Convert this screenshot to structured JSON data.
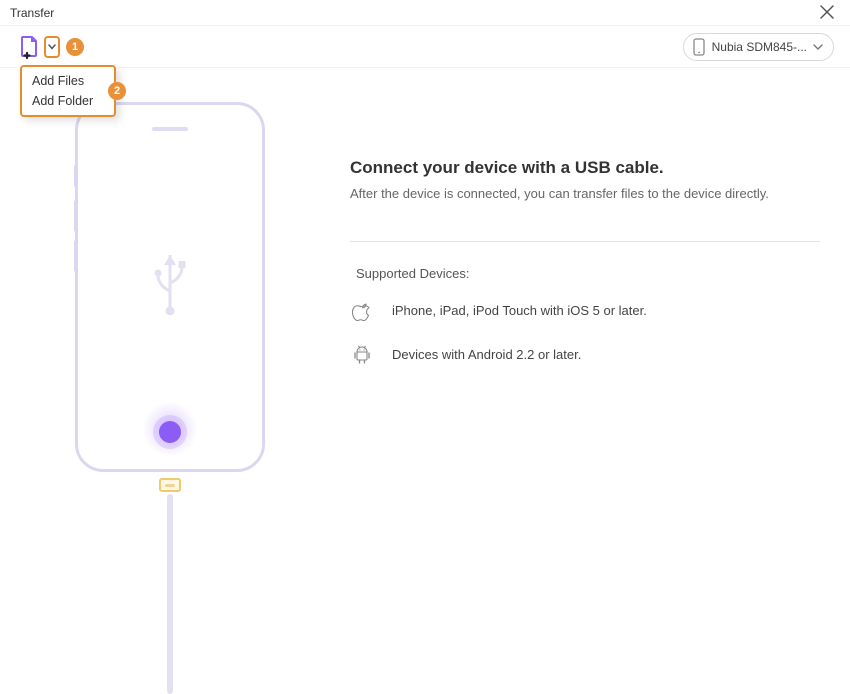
{
  "window": {
    "title": "Transfer"
  },
  "toolbar": {
    "dropdown": {
      "items": [
        {
          "label": "Add Files"
        },
        {
          "label": "Add Folder"
        }
      ]
    },
    "badges": {
      "one": "1",
      "two": "2"
    },
    "device": {
      "selected": "Nubia SDM845-..."
    }
  },
  "main": {
    "connect_title": "Connect your device with a USB cable.",
    "connect_subtitle": "After the device is connected, you can transfer files to the device directly.",
    "supported_heading": "Supported Devices:",
    "devices": [
      {
        "text": "iPhone, iPad, iPod Touch with iOS 5 or later."
      },
      {
        "text": "Devices with Android 2.2 or later."
      }
    ]
  }
}
